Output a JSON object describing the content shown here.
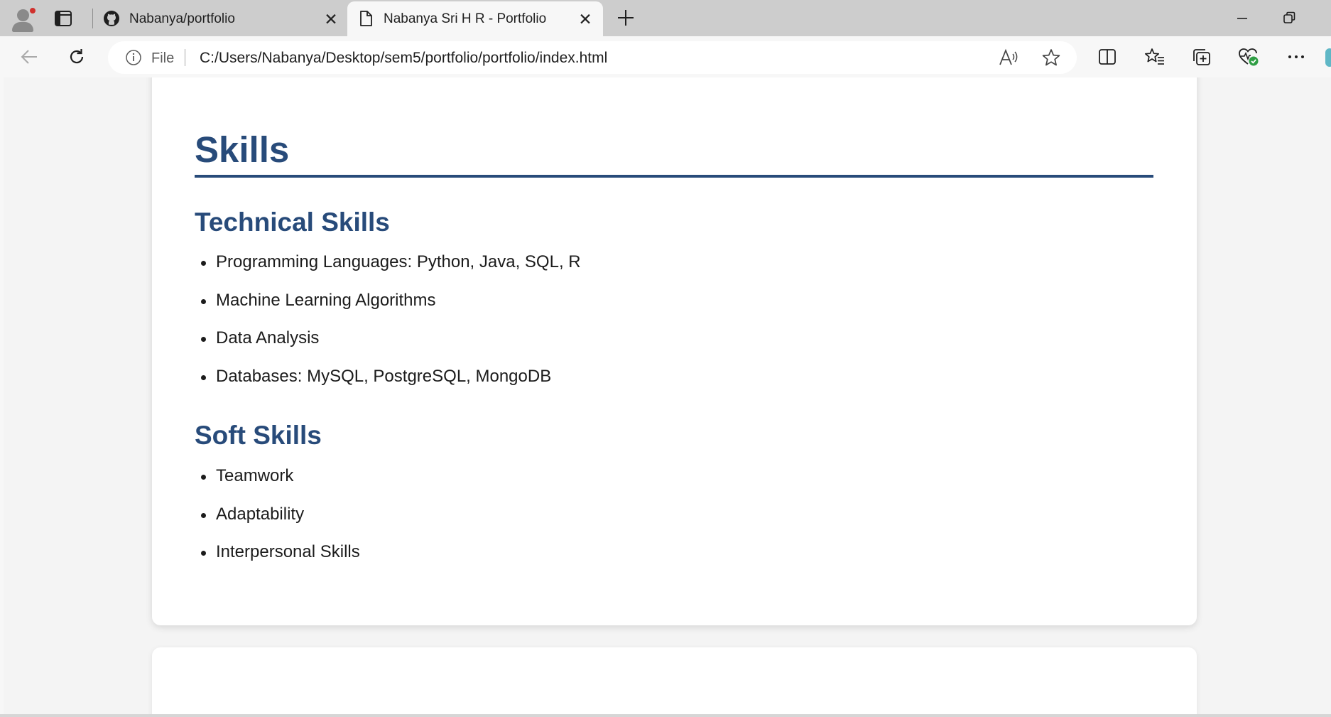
{
  "browser": {
    "tabs": [
      {
        "title": "Nabanya/portfolio",
        "favicon": "github-icon"
      },
      {
        "title": "Nabanya Sri H R - Portfolio",
        "favicon": "document-icon",
        "active": true
      }
    ],
    "address_bar": {
      "scheme_label": "File",
      "url": "C:/Users/Nabanya/Desktop/sem5/portfolio/portfolio/index.html"
    }
  },
  "page": {
    "heading": "Skills",
    "sections": [
      {
        "title": "Technical Skills",
        "items": [
          "Programming Languages: Python, Java, SQL, R",
          "Machine Learning Algorithms",
          "Data Analysis",
          "Databases: MySQL, PostgreSQL, MongoDB"
        ]
      },
      {
        "title": "Soft Skills",
        "items": [
          "Teamwork",
          "Adaptability",
          "Interpersonal Skills"
        ]
      }
    ]
  },
  "colors": {
    "heading": "#284b7a",
    "tabstrip": "#cdcdcd",
    "toolbar": "#f7f7f7"
  }
}
